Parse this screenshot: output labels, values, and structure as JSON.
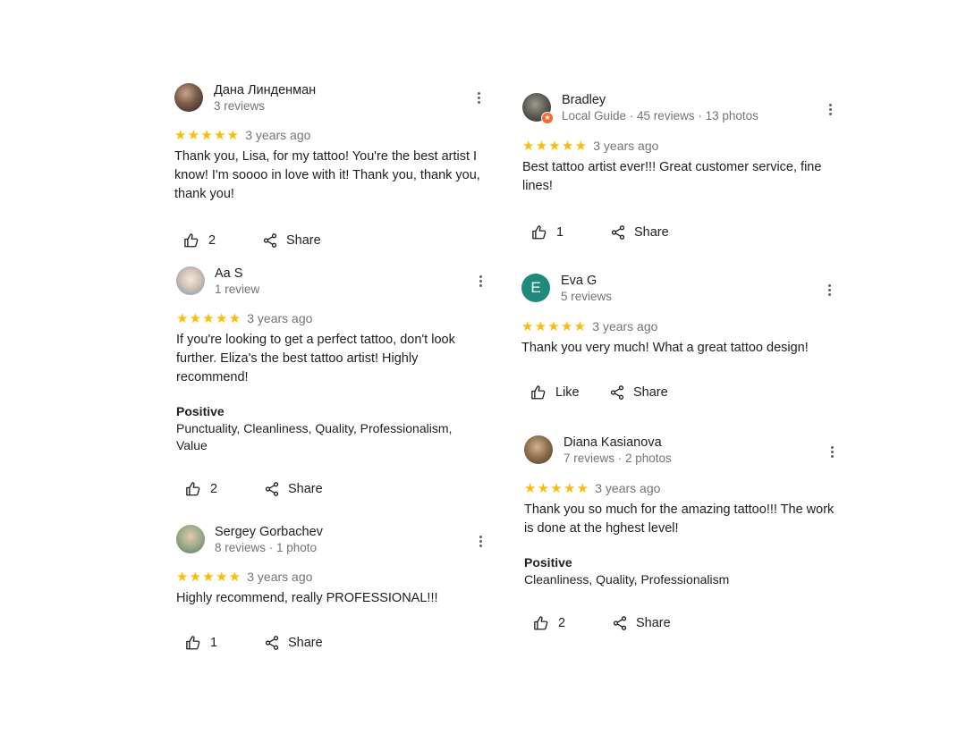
{
  "colors": {
    "star": "#fbbc04",
    "meta": "#70757a",
    "text": "#202124",
    "eva_avatar": "#1e8a7a",
    "guide_badge": "#f36d2b"
  },
  "icons": {
    "like": "thumb-up-icon",
    "share": "share-icon",
    "more": "more-vert-icon",
    "star": "star-icon"
  },
  "reviews": [
    {
      "name": "Дана Линденман",
      "meta": "3 reviews",
      "stars": "★★★★★",
      "rating": 5,
      "time": "3 years ago",
      "text": "Thank you, Lisa, for my tattoo! You're the best artist I know! I'm soooo in love with it! Thank you, thank you, thank you!",
      "likes": "2",
      "share": "Share"
    },
    {
      "name": "Aa S",
      "meta": "1 review",
      "stars": "★★★★★",
      "rating": 5,
      "time": "3 years ago",
      "text": "If you're looking to get a perfect tattoo, don't look further. Eliza's the best tattoo artist! Highly recommend!",
      "positive_heading": "Positive",
      "positive_values": "Punctuality, Cleanliness, Quality, Professionalism, Value",
      "likes": "2",
      "share": "Share"
    },
    {
      "name": "Sergey Gorbachev",
      "meta": "8 reviews · 1 photo",
      "stars": "★★★★★",
      "rating": 5,
      "time": "3 years ago",
      "text": "Highly recommend, really PROFESSIONAL!!!",
      "likes": "1",
      "share": "Share"
    },
    {
      "name": "Bradley",
      "meta": "Local Guide · 45 reviews · 13 photos",
      "stars": "★★★★★",
      "rating": 5,
      "time": "3 years ago",
      "text": "Best tattoo artist ever!!! Great customer service, fine lines!",
      "likes": "1",
      "share": "Share"
    },
    {
      "name": "Eva G",
      "initial": "E",
      "meta": "5 reviews",
      "stars": "★★★★★",
      "rating": 5,
      "time": "3 years ago",
      "text": "Thank you very much! What a great tattoo design!",
      "likes": "Like",
      "share": "Share"
    },
    {
      "name": "Diana Kasianova",
      "meta": "7 reviews · 2 photos",
      "stars": "★★★★★",
      "rating": 5,
      "time": "3 years ago",
      "text": "Thank you so much for the amazing tattoo!!! The work is done at the hghest level!",
      "positive_heading": "Positive",
      "positive_values": "Cleanliness, Quality, Professionalism",
      "likes": "2",
      "share": "Share"
    }
  ]
}
